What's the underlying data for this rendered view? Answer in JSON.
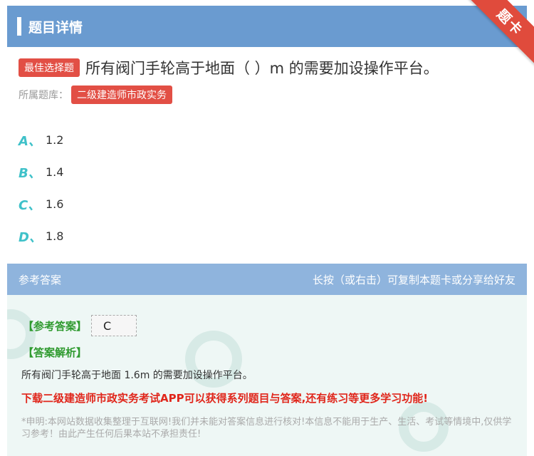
{
  "header": {
    "title": "题目详情"
  },
  "ribbon": {
    "label": "题卡"
  },
  "question": {
    "type_tag": "最佳选择题",
    "text": "所有阀门手轮高于地面（   ）m 的需要加设操作平台。"
  },
  "bank": {
    "label": "所属题库：",
    "name": "二级建造师市政实务"
  },
  "options": [
    {
      "letter": "A、",
      "value": "1.2"
    },
    {
      "letter": "B、",
      "value": "1.4"
    },
    {
      "letter": "C、",
      "value": "1.6"
    },
    {
      "letter": "D、",
      "value": "1.8"
    }
  ],
  "answer_section": {
    "title": "参考答案",
    "hint": "长按（或右击）可复制本题卡或分享给好友",
    "answer_label": "【参考答案】",
    "answer_value": "C",
    "analysis_label": "【答案解析】",
    "analysis_text": "所有阀门手轮高于地面 1.6m 的需要加设操作平台。",
    "promo": "下载二级建造师市政实务考试APP可以获得系列题目与答案,还有练习等更多学习功能!",
    "disclaimer": "*申明:本网站数据收集整理于互联网!我们并未能对答案信息进行核对!本信息不能用于生产、生活、考试等情境中,仅供学习参考！由此产生任何后果本站不承担责任!"
  },
  "colors": {
    "header": "#6a9bd0",
    "answer_header": "#8fb4dd",
    "accent_red": "#e24f45",
    "option_letter": "#3fc1c9",
    "answer_green": "#2f9a2f",
    "promo_red": "#e0261b"
  }
}
